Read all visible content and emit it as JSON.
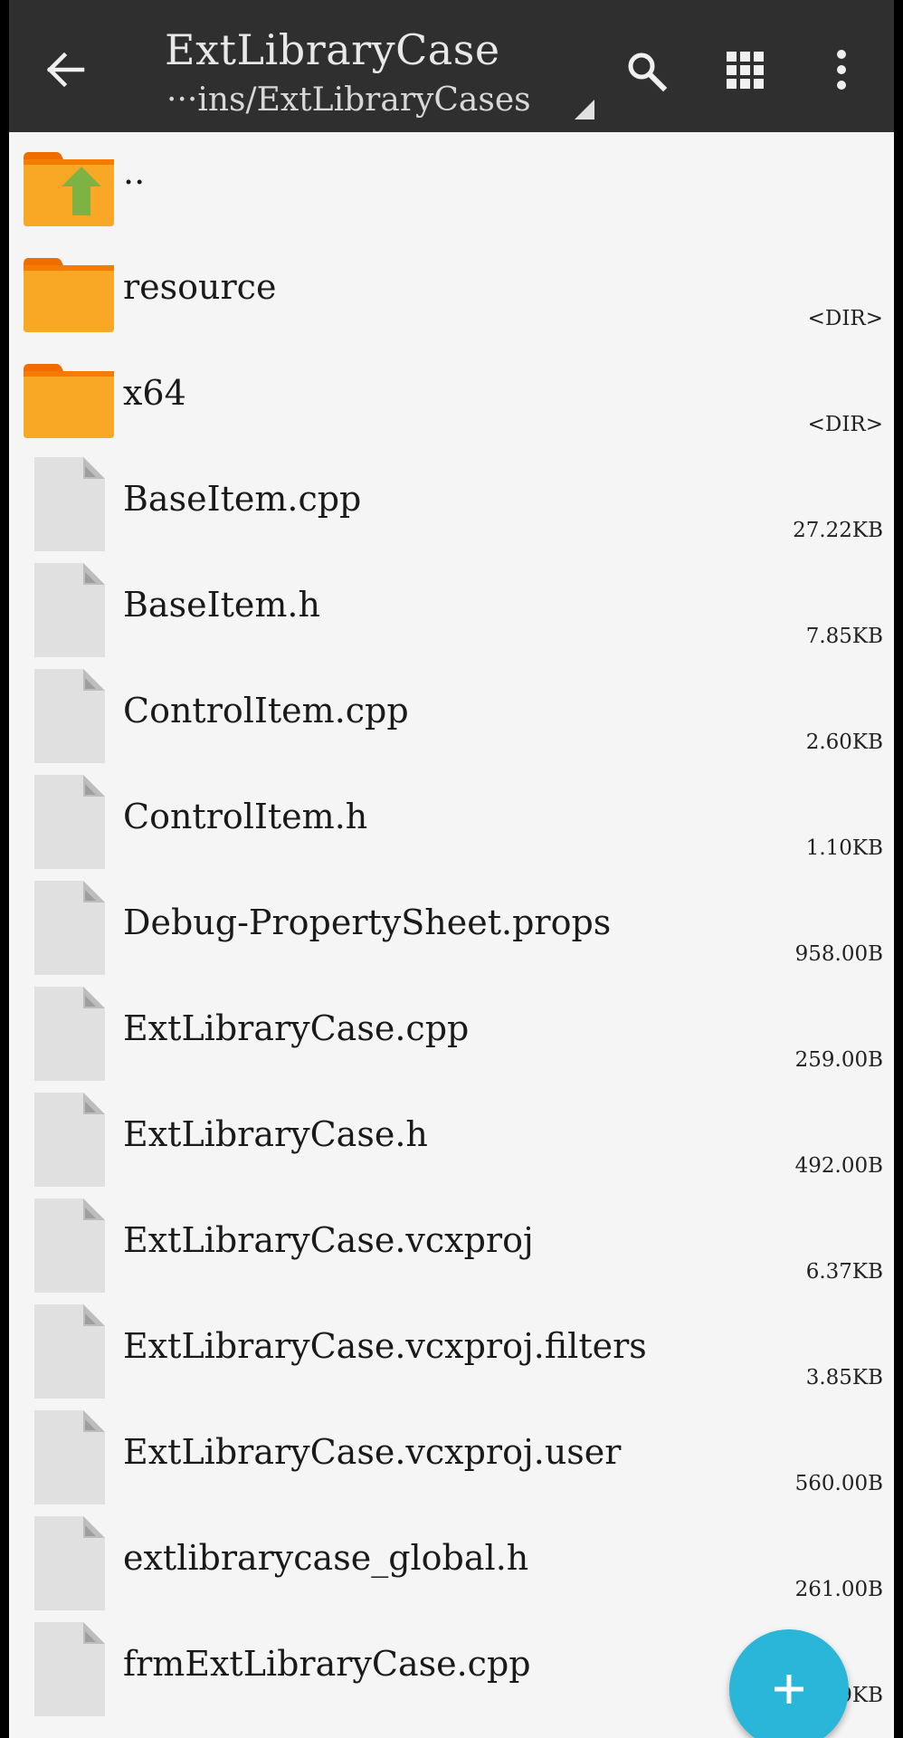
{
  "toolbar": {
    "title": "ExtLibraryCase",
    "path": "···ins/ExtLibraryCases",
    "back_icon": "arrow-left-icon",
    "search_icon": "search-icon",
    "grid_icon": "grid-view-icon",
    "more_icon": "more-vert-icon"
  },
  "files": [
    {
      "name": "..",
      "size": "",
      "kind": "parent-folder"
    },
    {
      "name": "resource",
      "size": "<DIR>",
      "kind": "folder"
    },
    {
      "name": "x64",
      "size": "<DIR>",
      "kind": "folder"
    },
    {
      "name": "BaseItem.cpp",
      "size": "27.22KB",
      "kind": "file"
    },
    {
      "name": "BaseItem.h",
      "size": "7.85KB",
      "kind": "file"
    },
    {
      "name": "ControlItem.cpp",
      "size": "2.60KB",
      "kind": "file"
    },
    {
      "name": "ControlItem.h",
      "size": "1.10KB",
      "kind": "file"
    },
    {
      "name": "Debug-PropertySheet.props",
      "size": "958.00B",
      "kind": "file"
    },
    {
      "name": "ExtLibraryCase.cpp",
      "size": "259.00B",
      "kind": "file"
    },
    {
      "name": "ExtLibraryCase.h",
      "size": "492.00B",
      "kind": "file"
    },
    {
      "name": "ExtLibraryCase.vcxproj",
      "size": "6.37KB",
      "kind": "file"
    },
    {
      "name": "ExtLibraryCase.vcxproj.filters",
      "size": "3.85KB",
      "kind": "file"
    },
    {
      "name": "ExtLibraryCase.vcxproj.user",
      "size": "560.00B",
      "kind": "file"
    },
    {
      "name": "extlibrarycase_global.h",
      "size": "261.00B",
      "kind": "file"
    },
    {
      "name": "frmExtLibraryCase.cpp",
      "size": "9KB",
      "kind": "file"
    }
  ],
  "fab": {
    "icon": "plus-icon"
  },
  "colors": {
    "toolbar": "#2f2f2f",
    "folder": "#f9a825",
    "folder_tab": "#ef6c00",
    "up_arrow": "#7cb342",
    "file_icon": "#e0e0e0",
    "fab": "#29b6d8"
  }
}
